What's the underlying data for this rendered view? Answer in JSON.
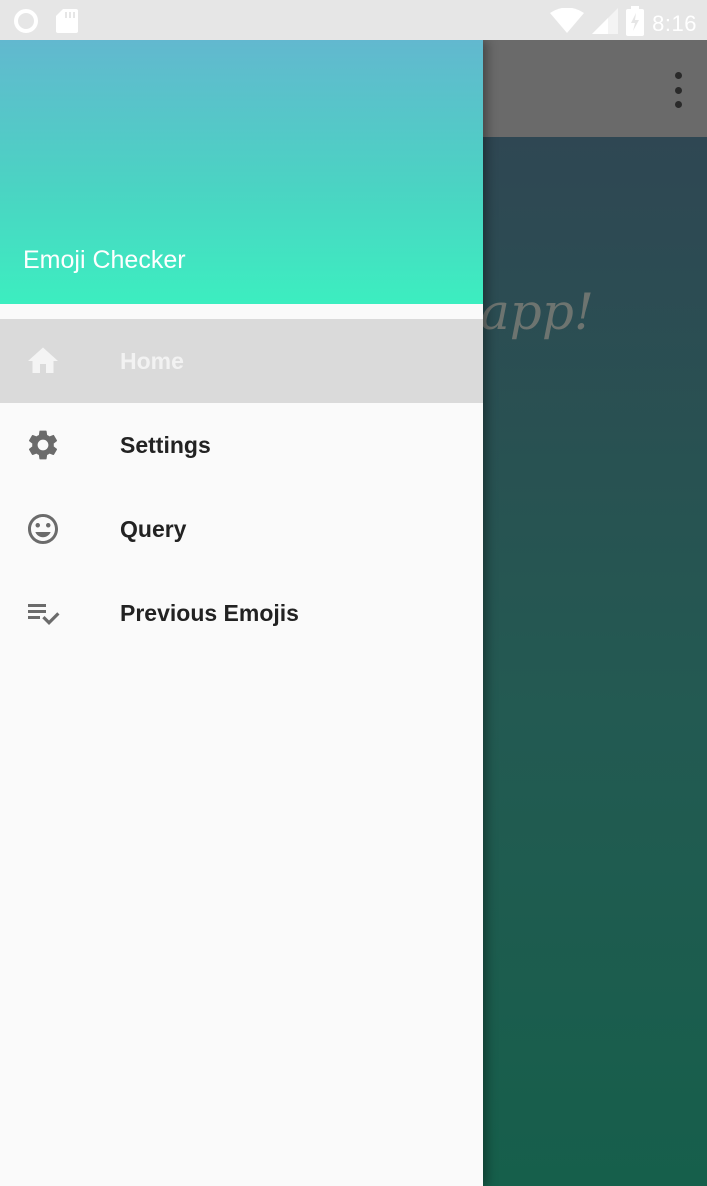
{
  "status_bar": {
    "time": "8:16",
    "icons": [
      "circle-notification-icon",
      "sd-card-icon",
      "wifi-icon",
      "cell-signal-icon",
      "battery-charging-icon"
    ]
  },
  "app": {
    "toolbar_menu_icon": "overflow-menu-icon",
    "welcome_text_fragment": "app!"
  },
  "drawer": {
    "header_title": "Emoji Checker",
    "items": [
      {
        "label": "Home",
        "icon": "home-icon",
        "active": true
      },
      {
        "label": "Settings",
        "icon": "gear-icon",
        "active": false
      },
      {
        "label": "Query",
        "icon": "smiley-icon",
        "active": false
      },
      {
        "label": "Previous Emojis",
        "icon": "playlist-check-icon",
        "active": false
      }
    ]
  },
  "colors": {
    "header_gradient_top": "#62b8cf",
    "header_gradient_bottom": "#3ceec0",
    "active_item_bg": "#dadada",
    "drawer_bg": "#fafafa",
    "toolbar_bg": "#6a6a6a"
  }
}
